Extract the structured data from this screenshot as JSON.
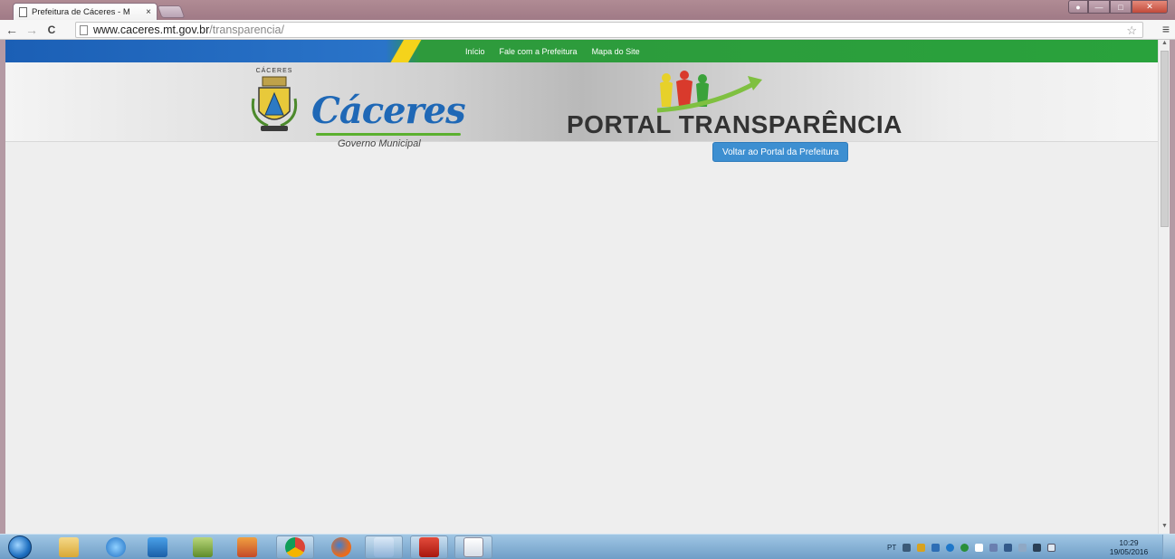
{
  "browser": {
    "tab_title": "Prefeitura de Cáceres - M",
    "tab_close": "×",
    "url_host": "www.caceres.mt.gov.br",
    "url_path": "/transparencia/",
    "back_glyph": "←",
    "forward_glyph": "→",
    "reload_glyph": "C",
    "star_glyph": "☆",
    "menu_glyph": "≡"
  },
  "site": {
    "nav_items": [
      "Início",
      "Fale com a Prefeitura",
      "Mapa do Site"
    ],
    "coat_of_arms_text": "CÁCERES",
    "logo_title": "Cáceres",
    "logo_subtitle": "Governo Municipal",
    "portal_title": "PORTAL TRANSPARÊNCIA",
    "back_button": "Voltar ao Portal da Prefeitura"
  },
  "taskbar": {
    "language": "PT",
    "time": "10:29",
    "date": "19/05/2016"
  },
  "colors": {
    "nav_green": "#29a23c",
    "nav_blue": "#1b5fb5",
    "logo_blue": "#1f68b6",
    "button_blue": "#3d8fd1",
    "page_bg": "#eeeeee"
  }
}
